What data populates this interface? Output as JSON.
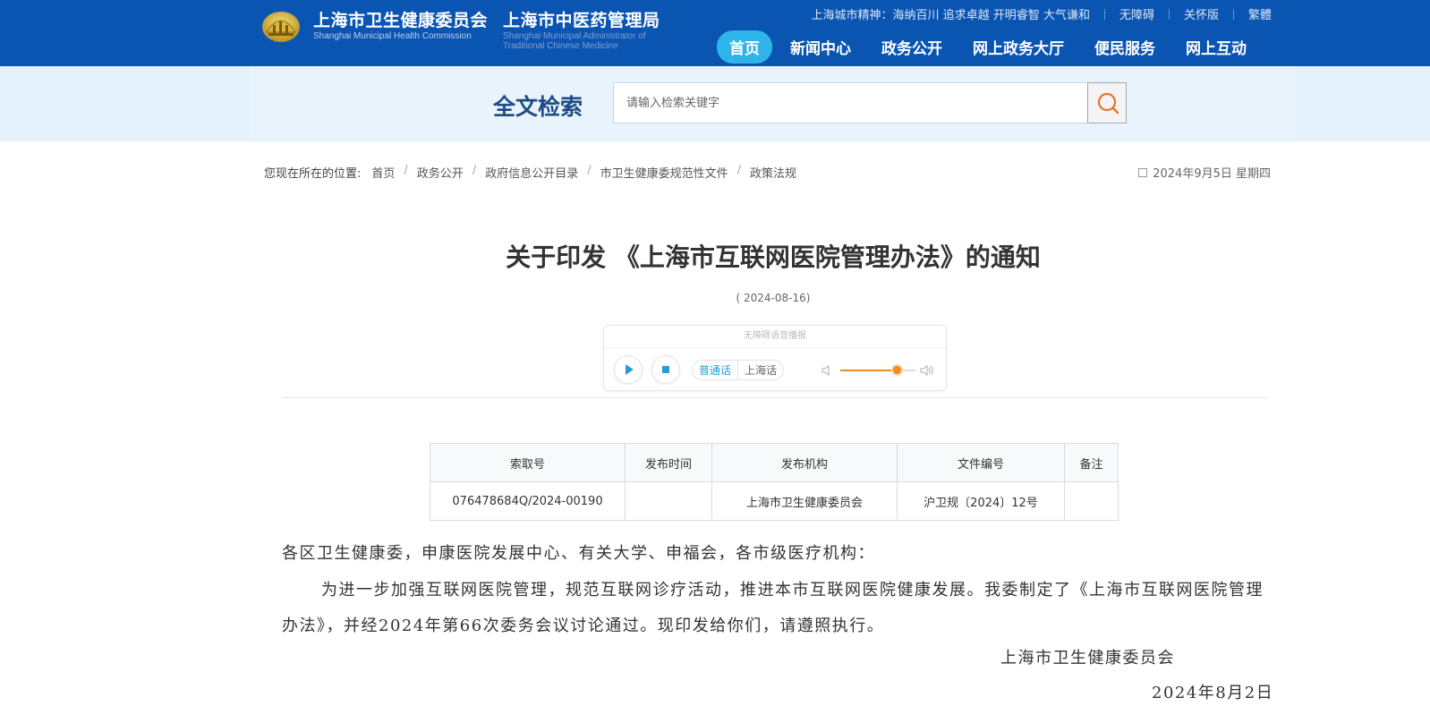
{
  "header": {
    "org_name": "上海市卫生健康委员会",
    "org_name_en": "Shanghai Municipal Health Commission",
    "org2_name": "上海市中医药管理局",
    "org2_name_en": "Shanghai Municipal Administrator of Traditional Chinese Medicine",
    "city_spirit": "上海城市精神：海纳百川 追求卓越 开明睿智 大气谦和",
    "links": [
      "无障碍",
      "关怀版",
      "繁體"
    ],
    "nav": [
      "首页",
      "新闻中心",
      "政务公开",
      "网上政务大厅",
      "便民服务",
      "网上互动"
    ],
    "active_nav": "首页"
  },
  "search": {
    "title": "全文检索",
    "placeholder": "请输入检索关键字"
  },
  "breadcrumb": {
    "lead": "您现在所在的位置:",
    "items": [
      "首页",
      "政务公开",
      "政府信息公开目录",
      "市卫生健康委规范性文件",
      "政策法规"
    ],
    "today": "2024年9月5日 星期四"
  },
  "article": {
    "title": "关于印发 《上海市互联网医院管理办法》的通知",
    "date": "( 2024-08-16)"
  },
  "player": {
    "label": "无障碍语音播报",
    "languages": [
      "普通话",
      "上海话"
    ],
    "active_language": "普通话",
    "volume": 0.75
  },
  "info_table": {
    "headers": [
      "索取号",
      "发布时间",
      "发布机构",
      "文件编号",
      "备注"
    ],
    "row": [
      "076478684Q/2024-00190",
      "",
      "上海市卫生健康委员会",
      "沪卫规〔2024〕12号",
      ""
    ]
  },
  "body": {
    "salutation": "各区卫生健康委，申康医院发展中心、有关大学、申福会，各市级医疗机构：",
    "paragraph": "为进一步加强互联网医院管理，规范互联网诊疗活动，推进本市互联网医院健康发展。我委制定了《上海市互联网医院管理办法》，并经2024年第66次委务会议讨论通过。现印发给你们，请遵照执行。",
    "signature": "上海市卫生健康委员会",
    "sign_date": "2024年8月2日"
  },
  "colors": {
    "header_bg": "#0b55b2",
    "nav_active": "#2fb4e9",
    "search_band": "#e5f1fb",
    "search_icon": "#e8742a",
    "volume_accent": "#f08a1e"
  }
}
